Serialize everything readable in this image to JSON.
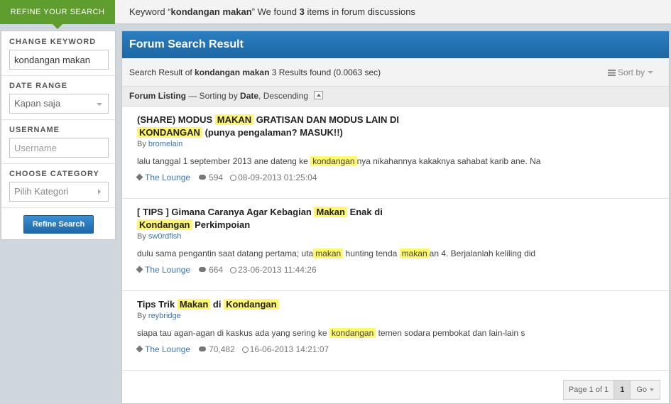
{
  "topbar": {
    "refine_tab": "REFINE YOUR SEARCH",
    "kw_prefix": "Keyword “",
    "kw_value": "kondangan makan",
    "kw_mid": "” We found ",
    "kw_count": "3",
    "kw_suffix": " items in forum discussions"
  },
  "sidebar": {
    "keyword_label": "CHANGE KEYWORD",
    "keyword_value": "kondangan makan",
    "date_label": "DATE RANGE",
    "date_value": "Kapan saja",
    "username_label": "USERNAME",
    "username_placeholder": "Username",
    "category_label": "CHOOSE CATEGORY",
    "category_value": "Pilih Kategori",
    "refine_button": "Refine Search"
  },
  "main": {
    "title": "Forum Search Result",
    "summary_prefix": "Search Result of ",
    "summary_keyword": "kondangan makan",
    "summary_suffix": " 3 Results found (0.0063 sec)",
    "sort_by": "Sort by",
    "listing_label": "Forum Listing",
    "listing_sorting": " — Sorting by ",
    "listing_date": "Date",
    "listing_order": ", Descending"
  },
  "results": [
    {
      "title_parts": [
        "(SHARE) MODUS ",
        "MAKAN",
        " GRATISAN DAN MODUS LAIN DI ",
        "KONDANGAN",
        " (punya pengalaman? MASUK!!)"
      ],
      "by_label": "By ",
      "author": "bromelain",
      "snippet_parts": [
        "lalu tanggal 1 september 2013 ane dateng ke ",
        "kondangan",
        "nya nikahannya kakaknya sahabat karib ane. Na"
      ],
      "category": "The Lounge",
      "comments": "594",
      "date": "08-09-2013 01:25:04"
    },
    {
      "title_parts": [
        "[ TIPS ] Gimana Caranya Agar Kebagian ",
        "Makan",
        " Enak di ",
        "Kondangan",
        " Perkimpoian"
      ],
      "by_label": "By ",
      "author": "sw0rdfish",
      "snippet_parts": [
        "dulu sama pengantin saat datang pertama; uta",
        "makan",
        " hunting tenda ",
        "makan",
        "an 4. Berjalanlah keliling did"
      ],
      "category": "The Lounge",
      "comments": "664",
      "date": "23-06-2013 11:44:26"
    },
    {
      "title_parts": [
        "Tips Trik ",
        "Makan",
        " di ",
        "Kondangan",
        ""
      ],
      "by_label": "By ",
      "author": "reybridge",
      "snippet_parts": [
        "siapa tau agan-agan di kaskus ada yang sering ke ",
        "kondangan",
        " temen sodara pembokat dan lain-lain s",
        "",
        ""
      ],
      "category": "The Lounge",
      "comments": "70,482",
      "date": "16-06-2013 14:21:07"
    }
  ],
  "pagination": {
    "info": "Page 1 of 1",
    "current": "1",
    "go": "Go"
  },
  "colors": {
    "green_tab": "#5f9e2e",
    "header_blue": "#1d66a3",
    "highlight": "#fff86e",
    "link": "#3a75b0"
  }
}
